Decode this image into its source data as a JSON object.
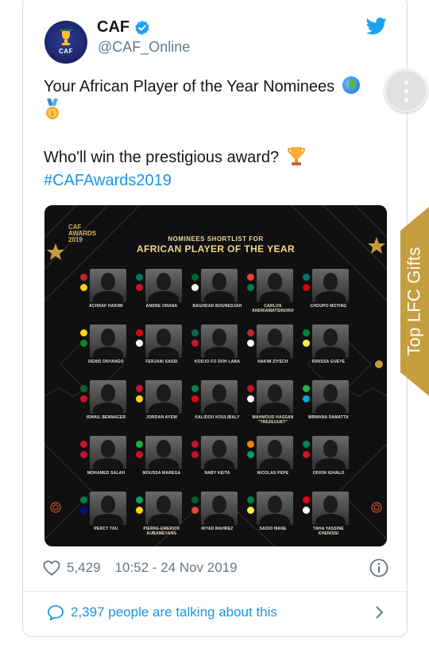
{
  "tweet": {
    "author": {
      "display_name": "CAF",
      "handle": "@CAF_Online",
      "avatar_text": "CAF",
      "verified": true
    },
    "text_line1": "Your African Player of the Year Nominees",
    "text_line2": "Who'll win the prestigious award?",
    "hashtag": "#CAFAwards2019",
    "emojis": [
      "globe-africa-icon",
      "medal-icon",
      "trophy-icon"
    ],
    "media": {
      "logo_text": "CAF\nAWARDS\n2019",
      "subtitle": "NOMINEES SHORTLIST FOR",
      "title": "AFRICAN PLAYER OF THE YEAR",
      "players": [
        {
          "name": "ACHRAF HAKIMI",
          "flags": [
            "#c1272d",
            "#f7d000"
          ]
        },
        {
          "name": "ANDRE ONANA",
          "flags": [
            "#007a5e",
            "#ce1126"
          ]
        },
        {
          "name": "BAGHDAD BOUNEDJAH",
          "flags": [
            "#006633",
            "#ffffff"
          ]
        },
        {
          "name": "CARLOS ANDRIAMATSINORO",
          "flags": [
            "#fc3d32",
            "#007e3a"
          ]
        },
        {
          "name": "CHOUPO MOTING",
          "flags": [
            "#007a5e",
            "#dd0000"
          ]
        },
        {
          "name": "DENIS ONYANGO",
          "flags": [
            "#fcdc04",
            "#078930"
          ]
        },
        {
          "name": "FERJANI SASSI",
          "flags": [
            "#e70013",
            "#ffffff"
          ]
        },
        {
          "name": "KODJO FO DOH LABA",
          "flags": [
            "#006a4e",
            "#d21034"
          ]
        },
        {
          "name": "HAKIM ZIYECH",
          "flags": [
            "#c1272d",
            "#ffffff"
          ]
        },
        {
          "name": "IDRISSA GUEYE",
          "flags": [
            "#00853f",
            "#fdef42"
          ]
        },
        {
          "name": "ISMAIL BENNACER",
          "flags": [
            "#006233",
            "#ce1126"
          ]
        },
        {
          "name": "JORDAN AYEW",
          "flags": [
            "#ce1126",
            "#fcd116"
          ]
        },
        {
          "name": "KALIDOU KOULIBALY",
          "flags": [
            "#00853f",
            "#e30613"
          ]
        },
        {
          "name": "MAHMOUD HASSAN \"TREZEGUET\"",
          "flags": [
            "#ce1126",
            "#ffffff"
          ]
        },
        {
          "name": "MBWANA SAMATTA",
          "flags": [
            "#1eb53a",
            "#00a3dd"
          ]
        },
        {
          "name": "MOHAMED SALAH",
          "flags": [
            "#ce1126",
            "#c8102e"
          ]
        },
        {
          "name": "MOUSSA MAREGA",
          "flags": [
            "#14b53a",
            "#ce1126"
          ]
        },
        {
          "name": "NABY KEITA",
          "flags": [
            "#ce1126",
            "#c8102e"
          ]
        },
        {
          "name": "NICOLAS PEPE",
          "flags": [
            "#f77f00",
            "#009e60"
          ]
        },
        {
          "name": "ODION IGHALO",
          "flags": [
            "#008751",
            "#ce1126"
          ]
        },
        {
          "name": "PERCY TAU",
          "flags": [
            "#007a4d",
            "#001489"
          ]
        },
        {
          "name": "PIERRE-EMERICK AUBAMEYANG",
          "flags": [
            "#009e60",
            "#fcd116"
          ]
        },
        {
          "name": "RIYAD MAHREZ",
          "flags": [
            "#006233",
            "#ef4135"
          ]
        },
        {
          "name": "SADIO MANE",
          "flags": [
            "#00853f",
            "#fdef42"
          ]
        },
        {
          "name": "TAHA YASSINE KHENISSI",
          "flags": [
            "#e70013",
            "#ffffff"
          ]
        }
      ]
    },
    "likes": "5,429",
    "timestamp": "10:52 - 24 Nov 2019",
    "conversation": "2,397 people are talking about this"
  },
  "side_tab": {
    "label": "Top LFC Gifts",
    "color": "#c59e3f"
  },
  "colors": {
    "accent": "#1b95e0",
    "muted": "#657786",
    "gold": "#f2d68a"
  }
}
